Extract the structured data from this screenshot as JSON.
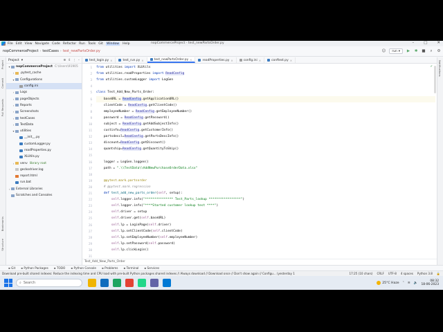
{
  "window": {
    "menu": [
      "File",
      "Edit",
      "View",
      "Navigate",
      "Code",
      "Refactor",
      "Run",
      "Tools",
      "Git",
      "Window",
      "Help"
    ],
    "active_menu_index": 9,
    "title": "nopCommerceProject - test_newPartsOrder.py"
  },
  "navbar": {
    "breadcrumbs": [
      "nopCommerceProject",
      "testCases",
      "test_newPartsOrder.py"
    ],
    "run_config": "run"
  },
  "left_strip": {
    "labels": [
      "Project",
      "Commit",
      "Pull Requests",
      "Bookmarks",
      "Structure"
    ]
  },
  "right_strip": {
    "labels": [
      "Notifications"
    ]
  },
  "project": {
    "header": "Project",
    "tree": [
      {
        "indent": 0,
        "arrow": "▾",
        "icon": "folder",
        "label": "nopCommerceProject",
        "extra": "C:\\Users\\91905",
        "bold": true
      },
      {
        "indent": 1,
        "arrow": "›",
        "icon": "folder yellow",
        "label": ".pytest_cache",
        "extra": ""
      },
      {
        "indent": 1,
        "arrow": "▾",
        "icon": "folder",
        "label": "Configurations",
        "extra": ""
      },
      {
        "indent": 2,
        "arrow": "",
        "icon": "inifile",
        "label": "config.ini",
        "extra": "",
        "selected": true
      },
      {
        "indent": 1,
        "arrow": "›",
        "icon": "folder",
        "label": "Logs",
        "extra": ""
      },
      {
        "indent": 1,
        "arrow": "›",
        "icon": "folder",
        "label": "pageObjects",
        "extra": ""
      },
      {
        "indent": 1,
        "arrow": "›",
        "icon": "folder",
        "label": "Reports",
        "extra": ""
      },
      {
        "indent": 1,
        "arrow": "›",
        "icon": "folder",
        "label": "Screenshots",
        "extra": ""
      },
      {
        "indent": 1,
        "arrow": "›",
        "icon": "folder",
        "label": "testCases",
        "extra": ""
      },
      {
        "indent": 1,
        "arrow": "›",
        "icon": "folder",
        "label": "TestData",
        "extra": ""
      },
      {
        "indent": 1,
        "arrow": "▾",
        "icon": "folder",
        "label": "utilities",
        "extra": ""
      },
      {
        "indent": 2,
        "arrow": "",
        "icon": "pyfile",
        "label": "__init__.py",
        "extra": ""
      },
      {
        "indent": 2,
        "arrow": "",
        "icon": "pyfile",
        "label": "customLogger.py",
        "extra": ""
      },
      {
        "indent": 2,
        "arrow": "",
        "icon": "pyfile",
        "label": "readProperties.py",
        "extra": ""
      },
      {
        "indent": 2,
        "arrow": "",
        "icon": "pyfile",
        "label": "XLUtils.py",
        "extra": ""
      },
      {
        "indent": 1,
        "arrow": "›",
        "icon": "folder yellow",
        "label": "venv",
        "extra": "library root",
        "green": true
      },
      {
        "indent": 1,
        "arrow": "",
        "icon": "logfile",
        "label": "geckodriver.log",
        "extra": ""
      },
      {
        "indent": 1,
        "arrow": "",
        "icon": "htmlfile",
        "label": "report.html",
        "extra": ""
      },
      {
        "indent": 1,
        "arrow": "",
        "icon": "pyfile",
        "label": "run.bat",
        "extra": ""
      },
      {
        "indent": 0,
        "arrow": "›",
        "icon": "folder",
        "label": "External Libraries",
        "extra": ""
      },
      {
        "indent": 0,
        "arrow": "",
        "icon": "folder",
        "label": "Scratches and Consoles",
        "extra": ""
      }
    ]
  },
  "tabs": [
    {
      "label": "test_login.py",
      "icon": "py",
      "active": false
    },
    {
      "label": "test_run.py",
      "icon": "py",
      "active": false
    },
    {
      "label": "test_newPartsOrder.py",
      "icon": "py",
      "active": true
    },
    {
      "label": "readProperties.py",
      "icon": "py",
      "active": false
    },
    {
      "label": "config.ini",
      "icon": "ini",
      "active": false
    },
    {
      "label": "conftest.py",
      "icon": "py",
      "active": false
    }
  ],
  "editor": {
    "current_line": 6,
    "lines": [
      {
        "n": "1",
        "html": "<span class=\"kw\">from</span> utilities <span class=\"kw\">import</span> XLUtils"
      },
      {
        "n": "2",
        "html": "<span class=\"kw\">from</span> utilities.readProperties <span class=\"kw\">import</span> <span class=\"hl\">ReadConfig</span>"
      },
      {
        "n": "3",
        "html": "<span class=\"kw\">from</span> utilities.customLogger <span class=\"kw\">import</span> LogGen"
      },
      {
        "n": "4",
        "html": ""
      },
      {
        "n": "5",
        "html": "<span class=\"kw\">class</span> Test_Add_New_Parts_Order:"
      },
      {
        "n": "6",
        "html": "    baseURL = <span class=\"hlbox\">ReadConfig</span>.getApplicationURL()"
      },
      {
        "n": "7",
        "html": "    clientCode = <span class=\"hl\">ReadConfig</span>.getClientCode()"
      },
      {
        "n": "8",
        "html": "    employeeNumber = <span class=\"hl\">ReadConfig</span>.getEmployeeNumber()"
      },
      {
        "n": "9",
        "html": "    password = <span class=\"hl\">ReadConfig</span>.getPassword()"
      },
      {
        "n": "10",
        "html": "    subject = <span class=\"hl\">ReadConfig</span>.getAddSubjectInfo()"
      },
      {
        "n": "11",
        "html": "    custinfo=<span class=\"hl\">ReadConfig</span>.getCustomerInfo()"
      },
      {
        "n": "12",
        "html": "    partsdescl=<span class=\"hl\">ReadConfig</span>.getPartsDescInfo()"
      },
      {
        "n": "13",
        "html": "    discount=<span class=\"hl\">ReadConfig</span>.getDiscount()"
      },
      {
        "n": "14",
        "html": "    quantship=<span class=\"hl\">ReadConfig</span>.getQuantityToShip()"
      },
      {
        "n": "15",
        "html": ""
      },
      {
        "n": "16",
        "html": "    logger = LogGen.loggen()"
      },
      {
        "n": "17",
        "html": "    path = <span class=\"str\">\".\\\\TestData\\\\AddNewPurchaseOrderData.xlsx\"</span>"
      },
      {
        "n": "18",
        "html": ""
      },
      {
        "n": "19",
        "html": "    <span class=\"dec\">@pytest.mark.partsorder</span>"
      },
      {
        "n": "20",
        "html": "    <span class=\"cmt\"># @pytest.mark.regression</span>"
      },
      {
        "n": "21",
        "html": "    <span class=\"kw\">def</span> <span class=\"fn\">test_add_new_parts_order</span>(<span class=\"slf\">self</span>, setup):"
      },
      {
        "n": "22",
        "html": "        <span class=\"slf\">self</span>.logger.info(<span class=\"str\">\"*************** Test_Parts_lookup *****************\"</span>)"
      },
      {
        "n": "23",
        "html": "        <span class=\"slf\">self</span>.logger.info(<span class=\"str\">\"****Started customer lookup test ****\"</span>)"
      },
      {
        "n": "24",
        "html": "        <span class=\"slf\">self</span>.driver = setup"
      },
      {
        "n": "25",
        "html": "        <span class=\"slf\">self</span>.driver.get(<span class=\"slf\">self</span>.baseURL)"
      },
      {
        "n": "26",
        "html": "        <span class=\"slf\">self</span>.lp = LoginPage(<span class=\"slf\">self</span>.driver)"
      },
      {
        "n": "27",
        "html": "        <span class=\"slf\">self</span>.lp.setClientCode(<span class=\"slf\">self</span>.clientCode)"
      },
      {
        "n": "28",
        "html": "        <span class=\"slf\">self</span>.lp.setEmployeeNumber(<span class=\"slf\">self</span>.employeeNumber)"
      },
      {
        "n": "29",
        "html": "        <span class=\"slf\">self</span>.lp.setPassword(<span class=\"slf\">self</span>.password)"
      },
      {
        "n": "30",
        "html": "        <span class=\"slf\">self</span>.lp.clickLogin()"
      },
      {
        "n": "31",
        "html": ""
      }
    ],
    "breadcrumb": "Test_Add_New_Parts_Order"
  },
  "toolwindows": [
    "Git",
    "Python Packages",
    "TODO",
    "Python Console",
    "Problems",
    "Terminal",
    "Services"
  ],
  "status": {
    "message": "Download pre-built shared indexes: Reduce the indexing time and CPU load with pre-built Python packages shared indexes // Always download // Download once // Don't show again // Configu... (yesterday 1",
    "position": "17:25 (10 chars)",
    "line_sep": "CRLF",
    "encoding": "UTF-8",
    "indent": "4 spaces",
    "interpreter": "Python 3.8"
  },
  "taskbar": {
    "search_placeholder": "Search",
    "weather": "25°C  Haze",
    "time": "08:32",
    "date": "18-06-2023",
    "app_colors": [
      "#f0b400",
      "#0f6cbd",
      "#1da462",
      "#e34234",
      "#21d789",
      "#6264a7",
      "#0078d4"
    ]
  }
}
